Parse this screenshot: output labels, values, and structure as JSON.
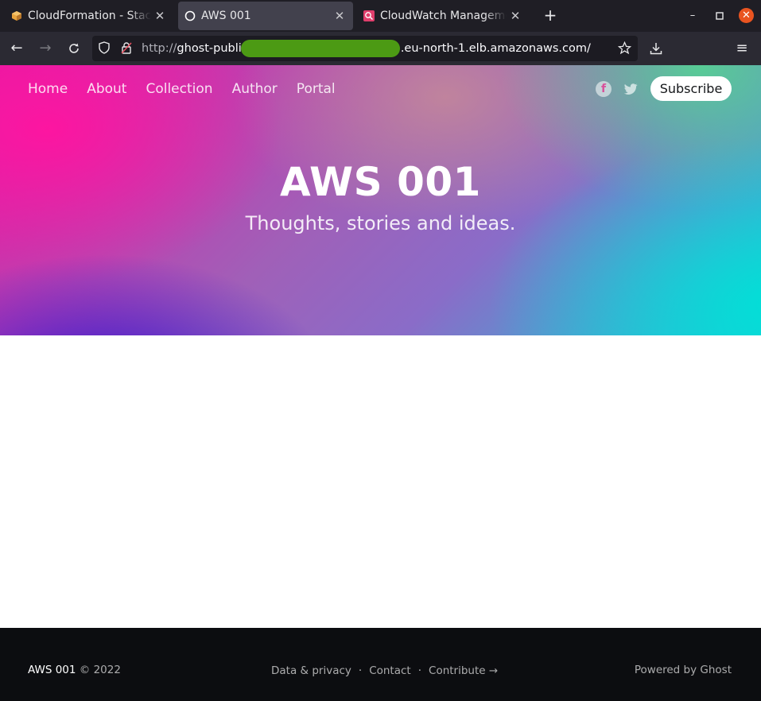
{
  "browser": {
    "tabs": [
      {
        "title": "CloudFormation - Stack g",
        "icon": "aws-cube-icon",
        "active": false
      },
      {
        "title": "AWS 001",
        "icon": "ghost-icon",
        "active": true
      },
      {
        "title": "CloudWatch Managemen",
        "icon": "cloudwatch-icon",
        "active": false
      }
    ],
    "url": {
      "protocol": "http://",
      "host_start": "ghost-publi",
      "host_end": ".eu-north-1.elb.amazonaws.com/"
    },
    "colors": {
      "close_button": "#e95420",
      "redaction": "#4c9a14"
    }
  },
  "site": {
    "nav": [
      "Home",
      "About",
      "Collection",
      "Author",
      "Portal"
    ],
    "subscribe_label": "Subscribe",
    "title": "AWS 001",
    "description": "Thoughts, stories and ideas."
  },
  "footer": {
    "site_name": "AWS 001",
    "copyright": "© 2022",
    "links": [
      "Data & privacy",
      "Contact",
      "Contribute →"
    ],
    "powered_by": "Powered by Ghost"
  }
}
